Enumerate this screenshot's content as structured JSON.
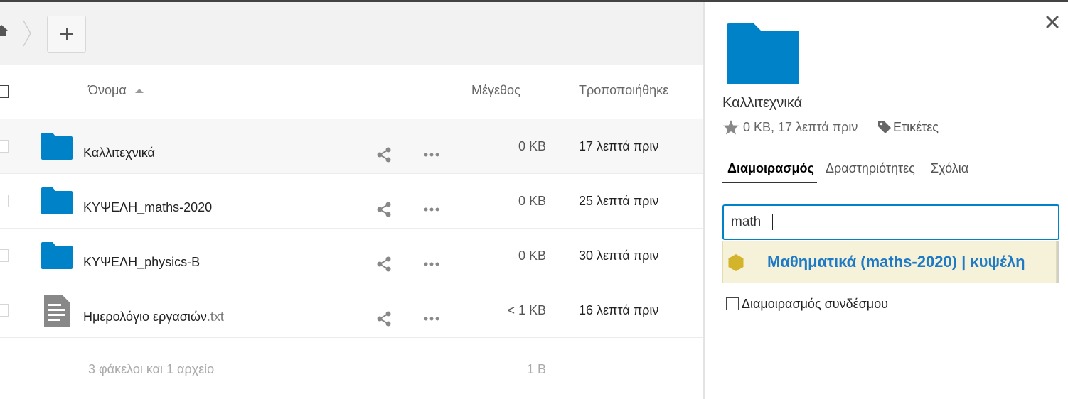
{
  "colors": {
    "accent": "#0082c9",
    "folder": "#0082c9",
    "file_icon": "#888888",
    "suggestion_text": "#1f7ac6",
    "suggestion_bg": "#f5f2d9",
    "hex_icon": "#d4b42a"
  },
  "controls": {
    "home_icon": "home-icon",
    "add_icon": "plus-icon"
  },
  "table": {
    "headers": {
      "name": "Όνομα",
      "size": "Μέγεθος",
      "modified": "Τροποποιήθηκε"
    },
    "sort": {
      "column": "name",
      "direction": "ascending"
    },
    "rows": [
      {
        "name": "Καλλιτεχνικά",
        "ext": "",
        "type": "folder",
        "size": "0 KB",
        "modified": "17 λεπτά πριν",
        "selected": true
      },
      {
        "name": "ΚΥΨΕΛΗ_maths-2020",
        "ext": "",
        "type": "folder",
        "size": "0 KB",
        "modified": "25 λεπτά πριν",
        "selected": false
      },
      {
        "name": "ΚΥΨΕΛΗ_physics-B",
        "ext": "",
        "type": "folder",
        "size": "0 KB",
        "modified": "30 λεπτά πριν",
        "selected": false
      },
      {
        "name": "Ημερολόγιο εργασιών",
        "ext": ".txt",
        "type": "file",
        "size": "< 1 KB",
        "modified": "16 λεπτά πριν",
        "selected": false
      }
    ],
    "summary": {
      "text": "3 φάκελοι και 1 αρχείο",
      "size": "1 B"
    }
  },
  "sidebar": {
    "title": "Καλλιτεχνικά",
    "meta": "0 KB, 17 λεπτά πριν",
    "tags_label": "Ετικέτες",
    "tabs": [
      {
        "label": "Διαμοιρασμός",
        "active": true
      },
      {
        "label": "Δραστηριότητες",
        "active": false
      },
      {
        "label": "Σχόλια",
        "active": false
      }
    ],
    "share_input": {
      "value": "math"
    },
    "suggestion": "Μαθηματικά (maths-2020) | κυψέλη",
    "link_share_label": "Διαμοιρασμός συνδέσμου"
  }
}
